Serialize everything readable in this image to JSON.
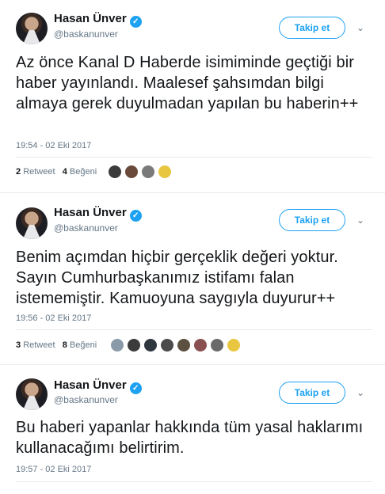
{
  "tweets": [
    {
      "name": "Hasan Ünver",
      "handle": "@baskanunver",
      "follow_label": "Takip et",
      "text": "Az önce Kanal D Haberde isimiminde geçtiği bir haber yayınlandı. Maalesef şahsımdan bilgi almaya gerek duyulmadan yapılan bu haberin++",
      "time": "19:54 - 02 Eki 2017",
      "retweets": "2",
      "retweet_label": "Retweet",
      "likes": "4",
      "like_label": "Beğeni",
      "liker_count": 4
    },
    {
      "name": "Hasan Ünver",
      "handle": "@baskanunver",
      "follow_label": "Takip et",
      "text": "Benim açımdan hiçbir gerçeklik değeri yoktur. Sayın Cumhurbaşkanımız istifamı falan istememiştir. Kamuoyuna saygıyla duyurur++",
      "time": "19:56 - 02 Eki 2017",
      "retweets": "3",
      "retweet_label": "Retweet",
      "likes": "8",
      "like_label": "Beğeni",
      "liker_count": 8
    },
    {
      "name": "Hasan Ünver",
      "handle": "@baskanunver",
      "follow_label": "Takip et",
      "text": "Bu haberi yapanlar hakkında tüm yasal haklarımı kullanacağımı belirtirim.",
      "time": "19:57 - 02 Eki 2017"
    }
  ],
  "icons": {
    "verified": "verified-check-icon",
    "more": "chevron-down-icon"
  },
  "colors": {
    "accent": "#1da1f2",
    "muted": "#657786",
    "text": "#14171a"
  }
}
